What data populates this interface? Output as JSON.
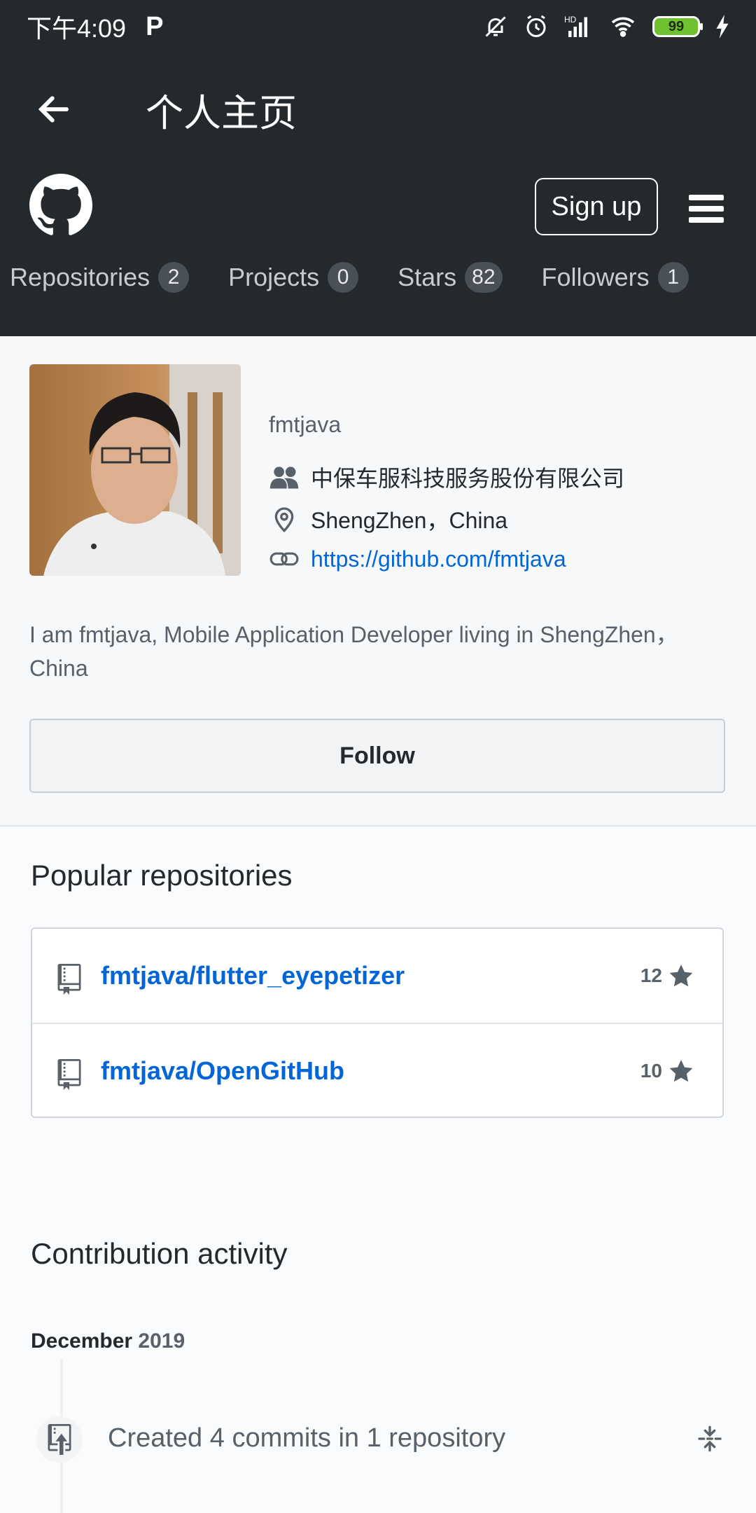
{
  "status_bar": {
    "time": "下午4:09",
    "app_indicator": "P",
    "battery": "99",
    "network": "HD"
  },
  "app_bar": {
    "title": "个人主页"
  },
  "header": {
    "signup_label": "Sign up",
    "tabs": [
      {
        "label": "Repositories",
        "count": "2"
      },
      {
        "label": "Projects",
        "count": "0"
      },
      {
        "label": "Stars",
        "count": "82"
      },
      {
        "label": "Followers",
        "count": "1"
      }
    ]
  },
  "profile": {
    "username": "fmtjava",
    "organization": "中保车服科技服务股份有限公司",
    "location": "ShengZhen，China",
    "website": "https://github.com/fmtjava",
    "bio": "I am fmtjava, Mobile Application Developer living in ShengZhen，China",
    "follow_label": "Follow"
  },
  "popular": {
    "title": "Popular repositories",
    "repos": [
      {
        "name": "fmtjava/flutter_eyepetizer",
        "stars": "12"
      },
      {
        "name": "fmtjava/OpenGitHub",
        "stars": "10"
      }
    ]
  },
  "activity": {
    "title": "Contribution activity",
    "month": "December",
    "year": "2019",
    "item": "Created 4 commits in 1 repository"
  },
  "colors": {
    "header_bg": "#24292e",
    "link": "#0366d6",
    "battery": "#6fc12f"
  }
}
